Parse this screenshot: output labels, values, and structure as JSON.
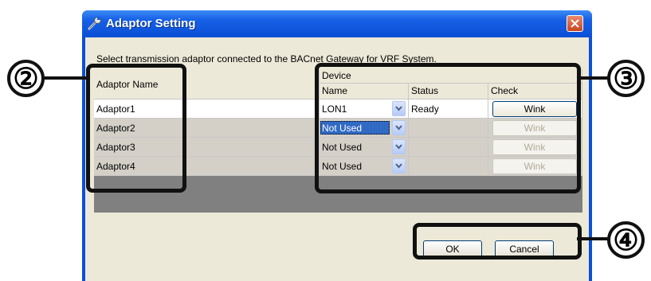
{
  "window": {
    "title": "Adaptor Setting",
    "icon": "wrench-icon",
    "close_icon": "close-icon"
  },
  "instruction": "Select transmission adaptor connected to the BACnet Gateway for VRF System.",
  "table": {
    "headers": {
      "adaptor_name": "Adaptor Name",
      "device": "Device",
      "name": "Name",
      "status": "Status",
      "check": "Check"
    },
    "rows": [
      {
        "adaptor": "Adaptor1",
        "device": "LON1",
        "status": "Ready",
        "check": "Wink"
      },
      {
        "adaptor": "Adaptor2",
        "device": "Not Used",
        "status": "",
        "check": "Wink"
      },
      {
        "adaptor": "Adaptor3",
        "device": "Not Used",
        "status": "",
        "check": "Wink"
      },
      {
        "adaptor": "Adaptor4",
        "device": "Not Used",
        "status": "",
        "check": "Wink"
      }
    ]
  },
  "buttons": {
    "ok": "OK",
    "cancel": "Cancel"
  },
  "callouts": [
    "②",
    "③",
    "④"
  ],
  "colors": {
    "titlebar": "#0a50d8",
    "client": "#ece9d8",
    "selection": "#316ac5",
    "callout": "#111111"
  }
}
